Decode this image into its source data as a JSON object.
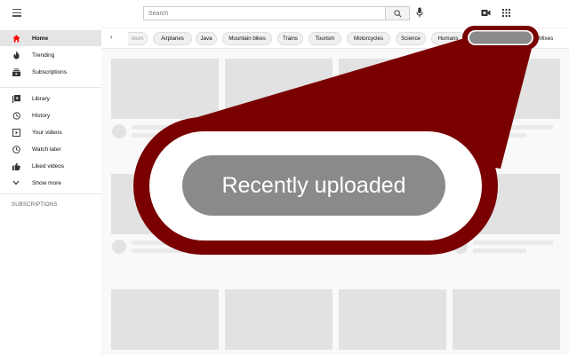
{
  "search": {
    "placeholder": "Search"
  },
  "sidebar": {
    "items": [
      {
        "label": "Home",
        "icon": "home-icon",
        "active": true
      },
      {
        "label": "Trending",
        "icon": "fire-icon"
      },
      {
        "label": "Subscriptions",
        "icon": "subscriptions-icon"
      },
      {
        "label": "Library",
        "icon": "library-icon"
      },
      {
        "label": "History",
        "icon": "history-icon"
      },
      {
        "label": "Your videos",
        "icon": "play-icon"
      },
      {
        "label": "Watch later",
        "icon": "clock-icon"
      },
      {
        "label": "Liked videos",
        "icon": "thumbs-up-icon"
      },
      {
        "label": "Show more",
        "icon": "chevron-down-icon"
      }
    ],
    "subscriptions_heading": "SUBSCRIPTIONS"
  },
  "chips": {
    "items": [
      "reum",
      "Airplanes",
      "Java",
      "Mountain bikes",
      "Trains",
      "Tourism",
      "Motorcycles",
      "Science",
      "Humans",
      "Recently uploaded",
      "Mixes"
    ],
    "selected": "Recently uploaded"
  },
  "zoom": {
    "label": "Recently uploaded"
  },
  "colors": {
    "accent": "#ff0000",
    "highlight_ring": "#7a0000",
    "chip_selected": "#8a8a8a"
  }
}
